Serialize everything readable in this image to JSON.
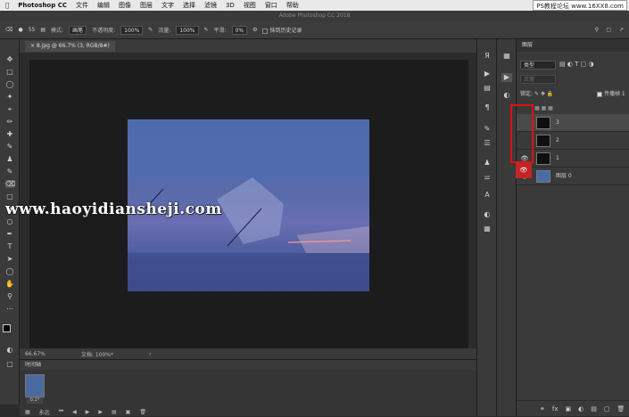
{
  "menubar": {
    "app": "Photoshop CC",
    "items": [
      "文件",
      "编辑",
      "图像",
      "图层",
      "文字",
      "选择",
      "滤镜",
      "3D",
      "视图",
      "窗口",
      "帮助"
    ],
    "watermark": "PS教程论坛  www.16XX8.com"
  },
  "titlebar": {
    "title": "Adobe Photoshop CC 2018"
  },
  "options": {
    "brush_size": "55",
    "mode_label": "模式:",
    "mode_value": "画笔",
    "opacity_label": "不透明度:",
    "opacity_value": "100%",
    "flow_label": "流量:",
    "flow_value": "100%",
    "smooth_label": "平滑:",
    "smooth_value": "0%",
    "history_label": "抹到历史记录"
  },
  "document": {
    "tab_label": "8.jpg @ 66.7% (3, RGB/8#)",
    "tab_close": "×"
  },
  "status": {
    "zoom": "66.67%",
    "doc": "文档: 100%*",
    "arrow": "›"
  },
  "timeline": {
    "title": "时间轴",
    "duration": "0.1*",
    "loop": "永远"
  },
  "layers_panel": {
    "title": "图层",
    "filter_label": "类型",
    "blend_label": "正常",
    "lock_label": "锁定:",
    "propagate_label": "传播帧 1",
    "layers": [
      {
        "name": "3",
        "visible": false
      },
      {
        "name": "2",
        "visible": false
      },
      {
        "name": "1",
        "visible": true
      },
      {
        "name": "图层 0",
        "visible": true
      }
    ]
  },
  "canvas_watermark": "www.haoyidiansheji.com",
  "colors": {
    "accent_red": "#d11111",
    "photo_blue": "#5a6aab"
  }
}
